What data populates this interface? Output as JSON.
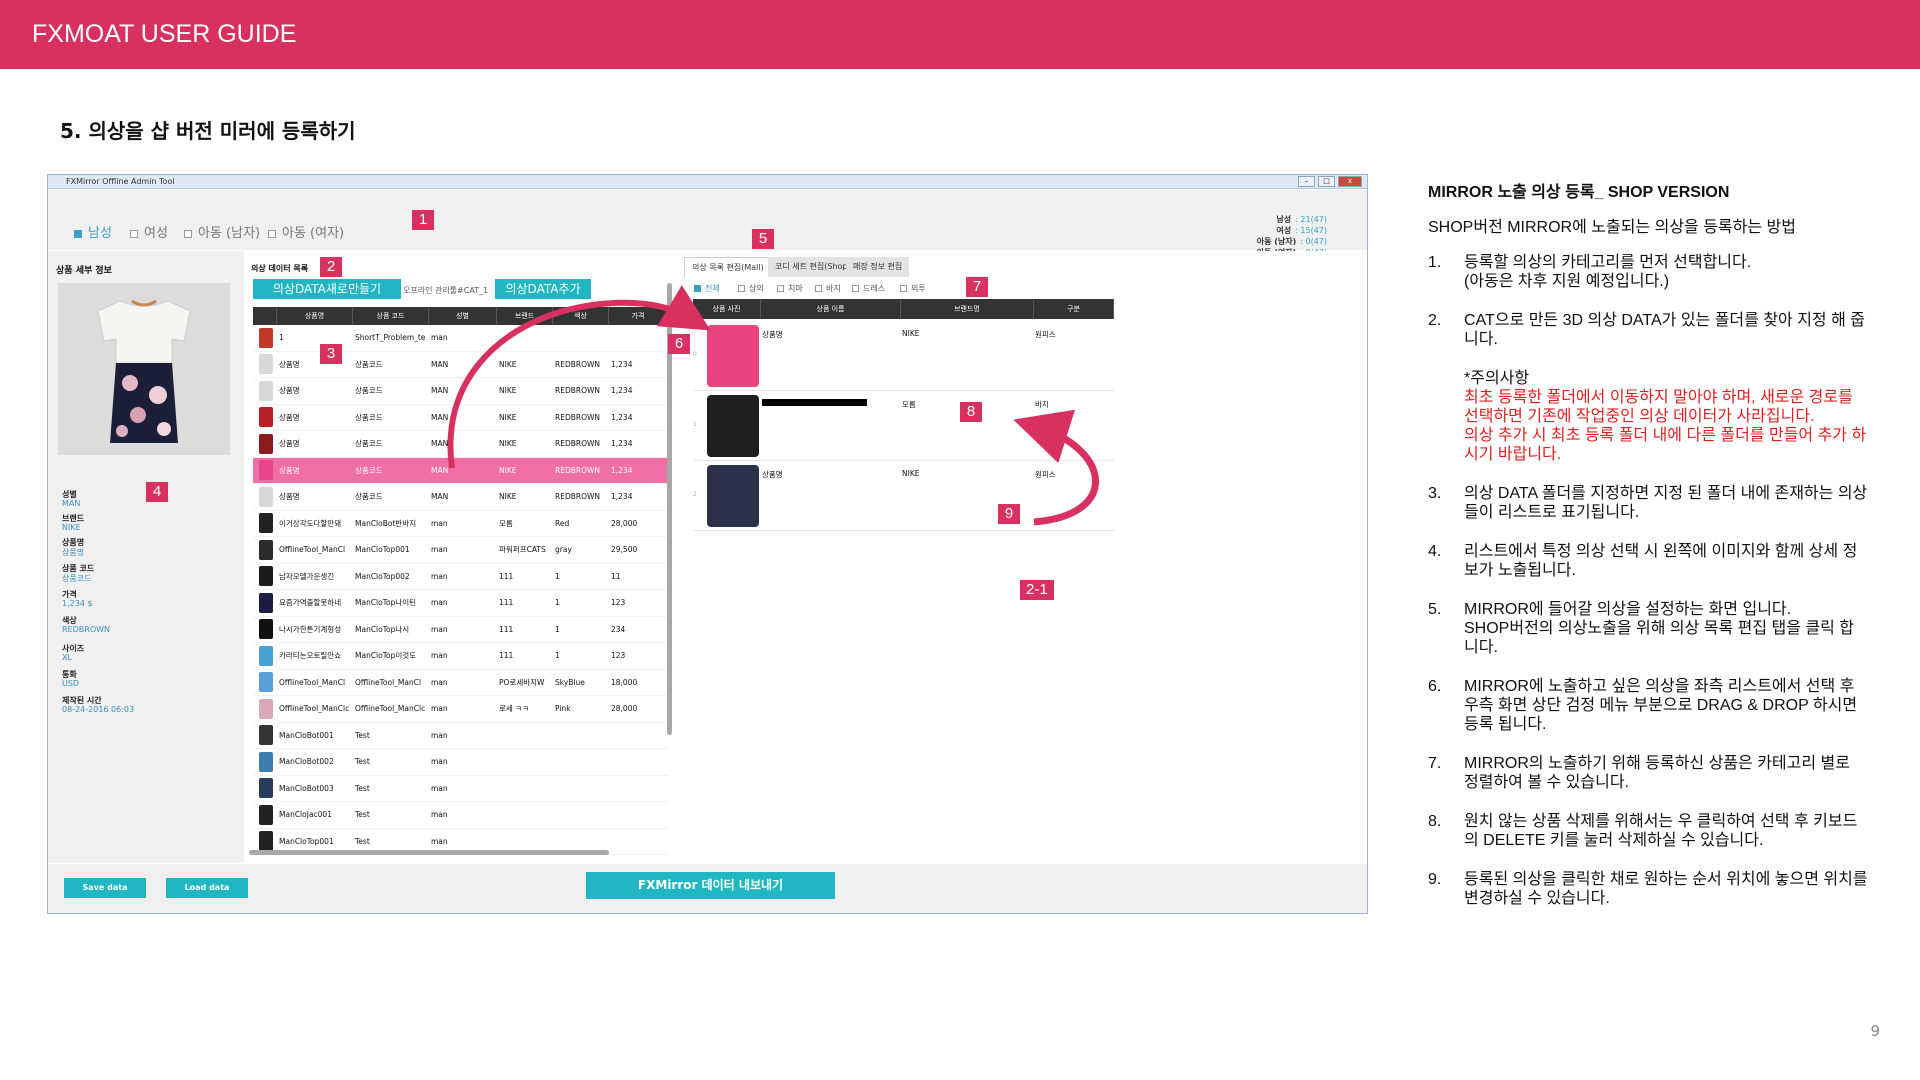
{
  "header": {
    "title": "FXMOAT USER GUIDE"
  },
  "section_title": "5. 의상을 샵 버전 미러에 등록하기",
  "window": {
    "title": "FXMirror Offline Admin Tool",
    "controls": [
      "–",
      "□",
      "x"
    ],
    "gender_tabs": [
      "남성",
      "여성",
      "아동 (남자)",
      "아동 (여자)"
    ],
    "counts": [
      {
        "label": "남성",
        "value": ": 21(47)"
      },
      {
        "label": "여성",
        "value": ": 15(47)"
      },
      {
        "label": "아동 (남자)",
        "value": ": 0(47)"
      },
      {
        "label": "아동 (여자)",
        "value": ": 0(47)"
      }
    ],
    "detail": {
      "heading": "상품 세부 정보",
      "fields": [
        {
          "label": "성별",
          "value": "MAN"
        },
        {
          "label": "브랜드",
          "value": "NIKE"
        },
        {
          "label": "상품명",
          "value": "상품명"
        },
        {
          "label": "상품 코드",
          "value": "상품코드"
        },
        {
          "label": "가격",
          "value": "1,234 $"
        },
        {
          "label": "색상",
          "value": "REDBROWN"
        },
        {
          "label": "사이즈",
          "value": "XL"
        },
        {
          "label": "통화",
          "value": "USD"
        },
        {
          "label": "제작된 시간",
          "value": "08-24-2016 06:03"
        }
      ]
    },
    "list": {
      "heading": "의상 데이터 목록",
      "new_button": "의상DATA새로만들기",
      "path": "오프라인 관리툴#CAT_1",
      "add_button": "의상DATA추가",
      "columns": [
        "상품명",
        "상품 코드",
        "성별",
        "브랜드",
        "색상",
        "가격"
      ],
      "rows": [
        [
          "1",
          "ShortT_Problem_te",
          "man",
          "",
          "",
          ""
        ],
        [
          "상품명",
          "상품코드",
          "MAN",
          "NIKE",
          "REDBROWN",
          "1,234"
        ],
        [
          "상품명",
          "상품코드",
          "MAN",
          "NIKE",
          "REDBROWN",
          "1,234"
        ],
        [
          "상품명",
          "상품코드",
          "MAN",
          "NIKE",
          "REDBROWN",
          "1,234"
        ],
        [
          "상품명",
          "상품코드",
          "MAN",
          "NIKE",
          "REDBROWN",
          "1,234"
        ],
        [
          "상품명",
          "상품코드",
          "MAN",
          "NIKE",
          "REDBROWN",
          "1,234"
        ],
        [
          "상품명",
          "상품코드",
          "MAN",
          "NIKE",
          "REDBROWN",
          "1,234"
        ],
        [
          "이거상각도다할만돼",
          "ManCloBot반바지",
          "man",
          "모름",
          "Red",
          "28,000"
        ],
        [
          "OfflineTool_ManCl",
          "ManCloTop001",
          "man",
          "파워퍼프CATS",
          "gray",
          "29,500"
        ],
        [
          "남자모델가운생긴",
          "ManCloTop002",
          "man",
          "111",
          "1",
          "11"
        ],
        [
          "요즘가역출할못하네",
          "ManCloTop나이틴",
          "man",
          "111",
          "1",
          "123"
        ],
        [
          "나시가한튼기계형성",
          "ManCloTop나시",
          "man",
          "111",
          "1",
          "234"
        ],
        [
          "카라티는오토릴안쇼",
          "ManCloTop이것도",
          "man",
          "111",
          "1",
          "123"
        ],
        [
          "OfflineTool_ManCl",
          "OfflineTool_ManCl",
          "man",
          "PO로세바지W",
          "SkyBlue",
          "18,000"
        ],
        [
          "OfflineTool_ManClc",
          "OfflineTool_ManClc",
          "man",
          "로세 ㅋㅋ",
          "Pink",
          "28,000"
        ],
        [
          "ManCloBot001",
          "Test",
          "man",
          "",
          "",
          ""
        ],
        [
          "ManCloBot002",
          "Test",
          "man",
          "",
          "",
          ""
        ],
        [
          "ManCloBot003",
          "Test",
          "man",
          "",
          "",
          ""
        ],
        [
          "ManCloJac001",
          "Test",
          "man",
          "",
          "",
          ""
        ],
        [
          "ManCloTop001",
          "Test",
          "man",
          "",
          "",
          ""
        ]
      ],
      "thumb_colors": [
        "#c0392b",
        "#d9d9d9",
        "#d9d9d9",
        "#b8202a",
        "#8b1a1a",
        "#e9458c",
        "#d9d9d9",
        "#222222",
        "#2a2a2a",
        "#1b1b1b",
        "#1d1d44",
        "#111111",
        "#4aa0d0",
        "#5aa0d8",
        "#d8a8b8",
        "#333333",
        "#3a7fb0",
        "#2a3a5a",
        "#222222",
        "#222222"
      ]
    },
    "right": {
      "tabs": [
        "의상 목록 편집(Mall)",
        "코디 세트 편집(Shop)",
        "매장 정보 편집"
      ],
      "filters": [
        "전체",
        "상의",
        "치마",
        "바지",
        "드레스",
        "외투"
      ],
      "columns": [
        "상품 사진",
        "상품 이름",
        "브랜드명",
        "구분"
      ],
      "rows": [
        {
          "idx": "0",
          "name": "상품명",
          "brand": "NIKE",
          "type": "원피스",
          "color": "#e8457e"
        },
        {
          "idx": "1",
          "name": "",
          "brand": "모름",
          "type": "바지",
          "color": "#1e1e1e"
        },
        {
          "idx": "2",
          "name": "상품명",
          "brand": "NIKE",
          "type": "원피스",
          "color": "#2b2f4a"
        }
      ]
    },
    "bottom": {
      "save": "Save data",
      "load": "Load data",
      "export": "FXMirror 데이터 내보내기"
    },
    "badges": [
      "1",
      "2",
      "3",
      "4",
      "5",
      "6",
      "7",
      "8",
      "9",
      "2-1"
    ]
  },
  "guide": {
    "title": "MIRROR 노출 의상 등록_ SHOP VERSION",
    "intro": "SHOP버전 MIRROR에 노출되는 의상을 등록하는 방법",
    "steps": [
      {
        "num": "1.",
        "lines": [
          "등록할 의상의 카테고리를 먼저 선택합니다.",
          "(아동은 차후 지원 예정입니다.)"
        ]
      },
      {
        "num": "2.",
        "lines": [
          "CAT으로 만든 3D 의상 DATA가 있는 폴더를 찾아 지정 해 줍니다."
        ],
        "note_head": "*주의사항",
        "warnings": [
          "최초 등록한 폴더에서 이동하지 말아야 하며, 새로운 경로를 선택하면 기존에 작업중인 의상 데이터가 사라집니다.",
          "의상 추가 시 최초 등록 폴더 내에 다른 폴더를 만들어 추가 하시기 바랍니다."
        ]
      },
      {
        "num": "3.",
        "lines": [
          "의상 DATA 폴더를 지정하면 지정 된 폴더 내에 존재하는 의상들이 리스트로 표기됩니다."
        ]
      },
      {
        "num": "4.",
        "lines": [
          "리스트에서 특정 의상 선택 시 왼쪽에 이미지와 함께 상세 정보가 노출됩니다."
        ]
      },
      {
        "num": "5.",
        "lines": [
          "MIRROR에 들어갈 의상을 설정하는 화면 입니다.",
          "SHOP버전의 의상노출을 위해 의상 목록 편집 탭을 클릭 합니다."
        ]
      },
      {
        "num": "6.",
        "lines": [
          "MIRROR에 노출하고 싶은 의상을 좌측 리스트에서 선택 후 우측 화면 상단 검정 메뉴 부분으로 DRAG & DROP 하시면 등록 됩니다."
        ]
      },
      {
        "num": "7.",
        "lines": [
          "MIRROR의 노출하기 위해 등록하신 상품은 카테고리 별로 정렬하여 볼 수 있습니다."
        ]
      },
      {
        "num": "8.",
        "lines": [
          "원치 않는 상품 삭제를 위해서는 우 클릭하여 선택 후 키보드의 DELETE 키를 눌러 삭제하실 수 있습니다."
        ]
      },
      {
        "num": "9.",
        "lines": [
          "등록된 의상을 클릭한 채로 원하는 순서 위치에 놓으면 위치를 변경하실 수 있습니다."
        ]
      }
    ]
  },
  "page_number": "9",
  "colors": {
    "accent": "#d8315f",
    "cyan": "#20b6c2",
    "link_blue": "#3aa0c4",
    "warning": "#e02020"
  }
}
